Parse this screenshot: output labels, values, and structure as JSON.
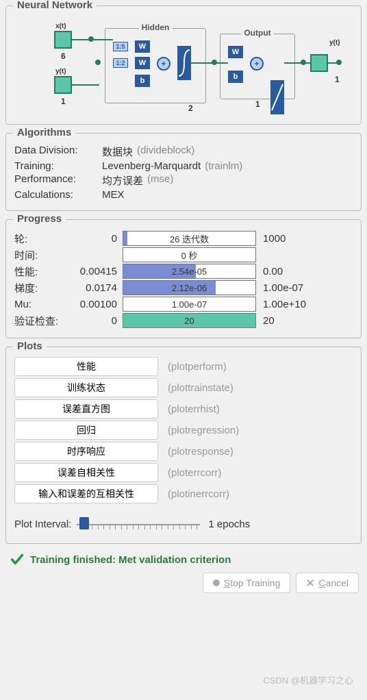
{
  "sections": {
    "neural_network": "Neural Network",
    "algorithms": "Algorithms",
    "progress": "Progress",
    "plots": "Plots"
  },
  "nn": {
    "hidden_label": "Hidden",
    "output_label": "Output",
    "x_label": "x(t)",
    "y_label": "y(t)",
    "out_label": "y(t)",
    "x_count": "6",
    "y_count": "1",
    "hidden_count": "2",
    "output_count": "1",
    "out_size": "1",
    "delay1": "1:5",
    "delay2": "1:2",
    "w": "W",
    "b": "b",
    "plus": "+"
  },
  "algorithms": {
    "rows": [
      {
        "label": "Data Division:",
        "value": "数据块",
        "fn": "(divideblock)"
      },
      {
        "label": "Training:",
        "value": "Levenberg-Marquardt",
        "fn": "(trainlm)"
      },
      {
        "label": "Performance:",
        "value": "均方误差",
        "fn": "(mse)"
      },
      {
        "label": "Calculations:",
        "value": "MEX",
        "fn": ""
      }
    ]
  },
  "progress": {
    "rows": [
      {
        "label": "轮:",
        "left": "0",
        "text": "26 迭代数",
        "right": "1000",
        "fill": 3,
        "color": "blue"
      },
      {
        "label": "时间:",
        "left": "",
        "text": "0 秒",
        "right": "",
        "fill": 0,
        "color": "blue"
      },
      {
        "label": "性能:",
        "left": "0.00415",
        "text": "2.54e-05",
        "right": "0.00",
        "fill": 55,
        "color": "blue"
      },
      {
        "label": "梯度:",
        "left": "0.0174",
        "text": "2.12e-06",
        "right": "1.00e-07",
        "fill": 70,
        "color": "blue"
      },
      {
        "label": "Mu:",
        "left": "0.00100",
        "text": "1.00e-07",
        "right": "1.00e+10",
        "fill": 0,
        "color": "blue"
      },
      {
        "label": "验证检查:",
        "left": "0",
        "text": "20",
        "right": "20",
        "fill": 100,
        "color": "green"
      }
    ]
  },
  "plots": {
    "items": [
      {
        "label": "性能",
        "fn": "(plotperform)"
      },
      {
        "label": "训练状态",
        "fn": "(plottrainstate)"
      },
      {
        "label": "误差直方图",
        "fn": "(ploterrhist)"
      },
      {
        "label": "回归",
        "fn": "(plotregression)"
      },
      {
        "label": "时序响应",
        "fn": "(plotresponse)"
      },
      {
        "label": "误差自相关性",
        "fn": "(ploterrcorr)"
      },
      {
        "label": "输入和误差的互相关性",
        "fn": "(plotinerrcorr)"
      }
    ],
    "interval_label": "Plot Interval:",
    "interval_value": "1 epochs"
  },
  "status": "Training finished: Met validation criterion",
  "buttons": {
    "stop": "Stop Training",
    "cancel": "Cancel"
  },
  "watermark": "CSDN @机器学习之心"
}
